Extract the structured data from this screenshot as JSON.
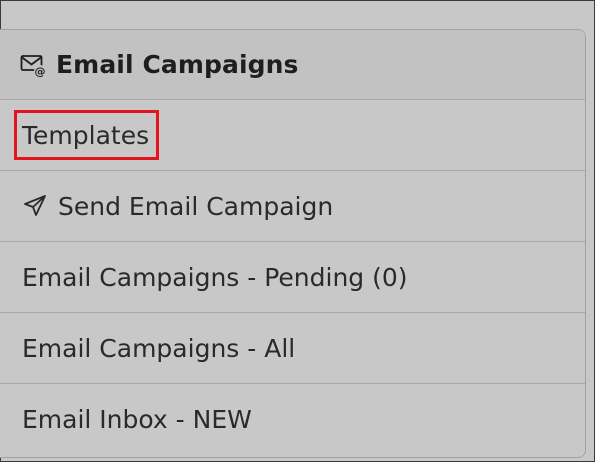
{
  "panel": {
    "title": "Email Campaigns",
    "title_icon": "envelope-at-icon"
  },
  "menu": {
    "items": [
      {
        "label": "Templates",
        "icon": null,
        "highlighted": true
      },
      {
        "label": "Send Email Campaign",
        "icon": "send-icon",
        "highlighted": false
      },
      {
        "label": "Email Campaigns - Pending (0)",
        "icon": null,
        "highlighted": false
      },
      {
        "label": "Email Campaigns - All",
        "icon": null,
        "highlighted": false
      },
      {
        "label": "Email Inbox - NEW",
        "icon": null,
        "highlighted": false
      }
    ]
  },
  "colors": {
    "background": "#c8c8c8",
    "header_background": "#c2c2c2",
    "highlight": "#e2141c",
    "text": "#2a2a2a"
  }
}
